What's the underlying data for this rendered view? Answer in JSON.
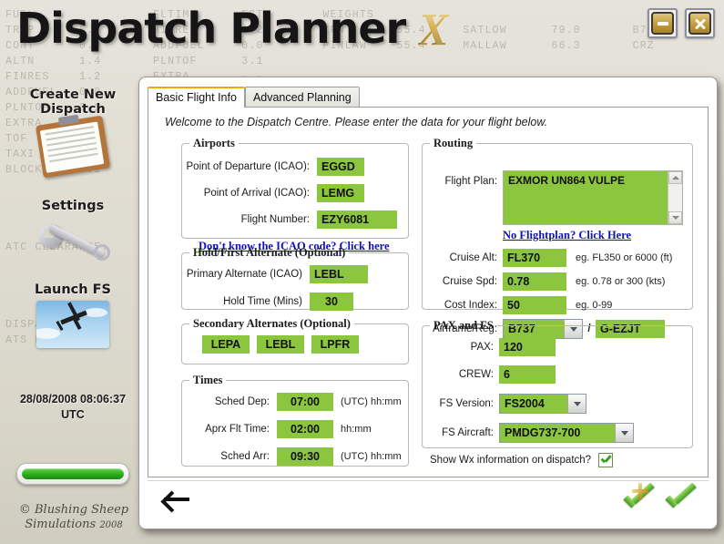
{
  "window": {
    "title": "Dispatch Planner",
    "title_suffix": "X",
    "minimize_label": "Minimize",
    "close_label": "Close"
  },
  "background_text": "FUEL                FLTIME      EST        WEIGHTS\nTRIP      5.8       MINRES      1.2        ZFW       55.4     SATLOW      79.0       B738/\nCONT      0.0       ADDFUEL     0.0        PINLAW    55.4     MALLAW      66.3       CRZ\nALTN      1.4       PLNTOF      3.1\nFINRES    1.2       EXTRA       -.-\nADDFUEL   0.0       TOF         -.-\nPLNTOF    3.1\nEXTRA     0.4       TAXI        0.3\nTOF       --        BLOCK       4.1\nTAXI      0.3\nBLOCK     4.1\n\n\n\n\nATC CLEARANCE:\n\n\n\n\nDISPATCH INFO:\nATS ROUTE:",
  "sidebar": {
    "items": [
      {
        "label": "Create New Dispatch",
        "icon": "clipboard-icon"
      },
      {
        "label": "Settings",
        "icon": "wrench-icon"
      },
      {
        "label": "Launch FS",
        "icon": "biplane-icon"
      }
    ],
    "clock_date_time": "28/08/2008 08:06:37",
    "clock_zone": "UTC",
    "progress_percent": 100,
    "copyright_line1": "© Blushing Sheep",
    "copyright_line2": "Simulations",
    "copyright_year": "2008"
  },
  "dialog": {
    "tabs": [
      {
        "label": "Basic Flight Info",
        "active": true
      },
      {
        "label": "Advanced Planning",
        "active": false
      }
    ],
    "welcome": "Welcome to the Dispatch Centre. Please enter the data for your flight below.",
    "airports": {
      "legend": "Airports",
      "departure_label": "Point of Departure (ICAO):",
      "departure_value": "EGGD",
      "arrival_label": "Point of Arrival (ICAO):",
      "arrival_value": "LEMG",
      "flight_number_label": "Flight Number:",
      "flight_number_value": "EZY6081",
      "icao_help_link": "Don't know the ICAO code? Click here"
    },
    "hold_alternate": {
      "legend": "Hold/First Alternate (Optional)",
      "primary_label": "Primary Alternate (ICAO)",
      "primary_value": "LEBL",
      "hold_time_label": "Hold Time (Mins)",
      "hold_time_value": "30"
    },
    "secondary_alternates": {
      "legend": "Secondary Alternates (Optional)",
      "values": [
        "LEPA",
        "LEBL",
        "LPFR"
      ]
    },
    "times": {
      "legend": "Times",
      "sched_dep_label": "Sched Dep:",
      "sched_dep_value": "07:00",
      "sched_dep_hint": "(UTC) hh:mm",
      "flt_time_label": "Aprx Flt Time:",
      "flt_time_value": "02:00",
      "flt_time_hint": "hh:mm",
      "sched_arr_label": "Sched Arr:",
      "sched_arr_value": "09:30",
      "sched_arr_hint": "(UTC) hh:mm"
    },
    "routing": {
      "legend": "Routing",
      "flight_plan_label": "Flight Plan:",
      "flight_plan_value": "EXMOR UN864 VULPE",
      "no_flightplan_link": "No Flightplan? Click Here",
      "cruise_alt_label": "Cruise Alt:",
      "cruise_alt_value": "FL370",
      "cruise_alt_hint": "eg. FL350 or 6000 (ft)",
      "cruise_spd_label": "Cruise Spd:",
      "cruise_spd_value": "0.78",
      "cruise_spd_hint": "eg. 0.78 or 300 (kts)",
      "cost_index_label": "Cost Index:",
      "cost_index_value": "50",
      "cost_index_hint": "eg. 0-99",
      "airframe_label": "Airframe/Reg:",
      "airframe_value": "B737",
      "airframe_separator": "/",
      "registration_value": "G-EZJT"
    },
    "pax_fs": {
      "legend": "PAX and FS",
      "pax_label": "PAX:",
      "pax_value": "120",
      "crew_label": "CREW:",
      "crew_value": "6",
      "fs_version_label": "FS Version:",
      "fs_version_value": "FS2004",
      "fs_aircraft_label": "FS Aircraft:",
      "fs_aircraft_value": "PMDG737-700",
      "show_wx_label": "Show Wx information on dispatch?",
      "show_wx_checked": true
    },
    "footer": {
      "back_label": "Back",
      "save_new_label": "Save as new dispatch",
      "confirm_label": "Confirm"
    }
  },
  "colors": {
    "field_green": "#8cc63f",
    "accent_gold": "#f0a800",
    "link_blue": "#1010c0"
  }
}
